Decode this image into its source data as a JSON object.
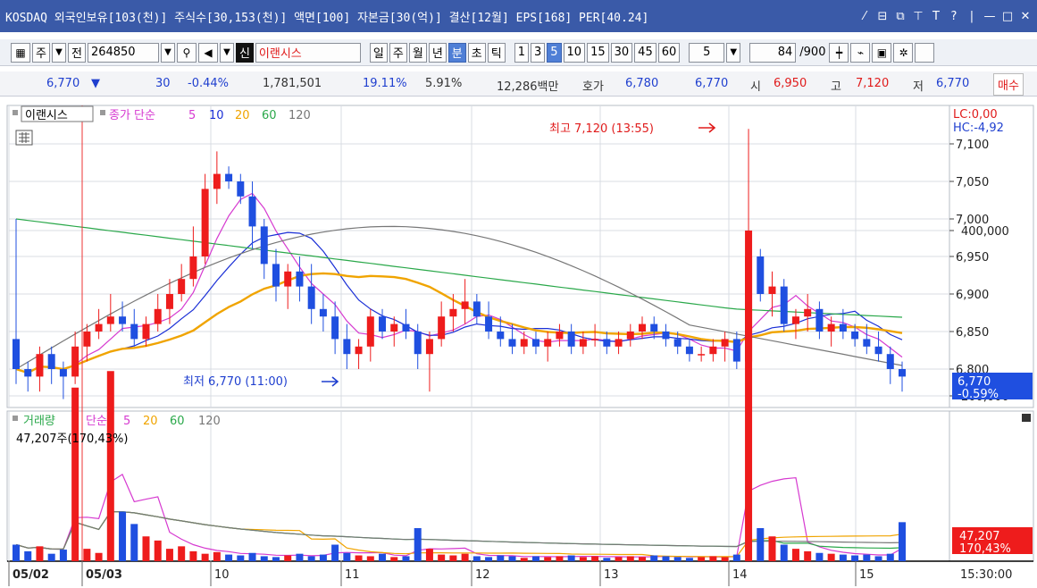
{
  "titlebar": {
    "text": "KOSDAQ 외국인보유[103(천)] 주식수[30,153(천)] 액면[100] 자본금[30(억)] 결산[12월] EPS[168] PER[40.24]",
    "controls": [
      "⁄",
      "⊟",
      "⧉",
      "⊤",
      "T",
      "?",
      "|",
      "—",
      "□",
      "✕"
    ]
  },
  "toolbar1": {
    "stock_type": "주",
    "prev_label": "전",
    "code": "264850",
    "stock_name": "이랜시스",
    "new_badge": "신",
    "periods": [
      "일",
      "주",
      "월",
      "년"
    ],
    "intervals": [
      "분",
      "초",
      "틱"
    ],
    "minute_options": [
      "1",
      "3",
      "5",
      "10",
      "15",
      "30",
      "45",
      "60"
    ],
    "selected_interval": "분",
    "selected_minute": "5",
    "minute_value": "5",
    "count_value": "84",
    "count_max": "/900"
  },
  "quote": {
    "price": "6,770",
    "change_arrow": "▼",
    "change": "30",
    "change_pct": "-0.44%",
    "volume": "1,781,501",
    "turnover": "19.11%",
    "foreign": "5.91%",
    "amount": "12,286백만",
    "hoga_label": "호가",
    "hoga_ask": "6,780",
    "hoga_bid": "6,770",
    "open_label": "시",
    "open": "6,950",
    "high_label": "고",
    "high": "7,120",
    "low_label": "저",
    "low": "6,770",
    "buy_button": "매수"
  },
  "price_panel": {
    "legend_name": "이랜시스",
    "legend_ma": "종가 단순",
    "ma_periods": [
      "5",
      "10",
      "20",
      "60",
      "120"
    ],
    "ma_colors": [
      "#d63ad0",
      "#1a2fd6",
      "#f0a400",
      "#2aa84a",
      "#777777"
    ],
    "lc": "LC:0,00",
    "hc": "HC:-4,92",
    "high_annotation": "최고 7,120 (13:55)",
    "low_annotation": "최저 6,770 (11:00)",
    "current_price": "6,770",
    "current_pct": "-0.59%"
  },
  "volume_panel": {
    "legend_name": "거래량",
    "legend_ma": "단순",
    "ma_periods": [
      "5",
      "20",
      "60",
      "120"
    ],
    "ma_colors": [
      "#d63ad0",
      "#f0a400",
      "#2aa84a",
      "#777777"
    ],
    "current_info": "47,207주(170,43%)",
    "current_volume": "47,207",
    "current_pct": "170,43%"
  },
  "xaxis": {
    "labels": [
      "05/02",
      "05/03",
      "10",
      "11",
      "12",
      "13",
      "14",
      "15"
    ],
    "time_label": "15:30:00"
  },
  "chart_data": {
    "type": "candlestick",
    "interval_minutes": 5,
    "price_axis": {
      "ticks": [
        6800,
        6850,
        6900,
        6950,
        7000,
        7050,
        7100
      ],
      "ylim": [
        6770,
        7120
      ]
    },
    "volume_axis": {
      "ticks": [
        200000,
        400000
      ],
      "ylim": [
        0,
        400000
      ]
    },
    "high": {
      "value": 7120,
      "time": "13:55"
    },
    "low": {
      "value": 6770,
      "time": "11:00"
    },
    "last": {
      "price": 6770,
      "change_pct": -0.59,
      "volume": 47207,
      "volume_pct": 170.43
    },
    "colors": {
      "up": "#ee1c1c",
      "down": "#1f4fe0",
      "grid": "#d9dce3"
    }
  }
}
